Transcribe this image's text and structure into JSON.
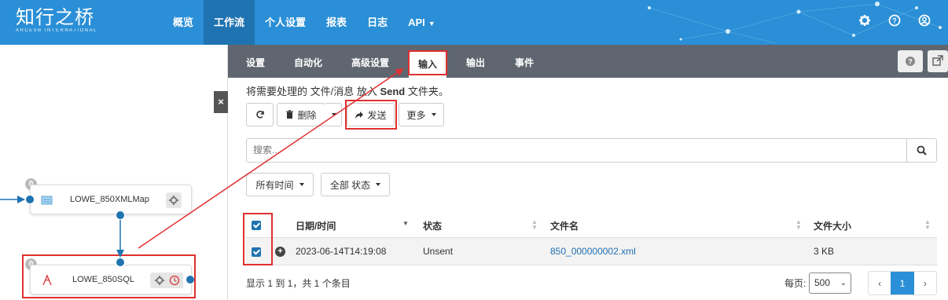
{
  "brand": {
    "name_cn": "知行之桥",
    "name_en": "ARCESB INTERNATIONAL"
  },
  "nav": {
    "items": [
      {
        "label": "概览",
        "active": false
      },
      {
        "label": "工作流",
        "active": true
      },
      {
        "label": "个人设置",
        "active": false
      },
      {
        "label": "报表",
        "active": false
      },
      {
        "label": "日志",
        "active": false
      },
      {
        "label": "API",
        "active": false
      }
    ],
    "icons": [
      "gear-icon",
      "help-icon",
      "user-icon"
    ]
  },
  "canvas": {
    "close_label": "×",
    "nodes": [
      {
        "label": "LOWE_850XMLMap",
        "badge": "0"
      },
      {
        "label": "LOWE_850SQL",
        "badge": "0"
      }
    ]
  },
  "tabs": [
    {
      "label": "设置"
    },
    {
      "label": "自动化"
    },
    {
      "label": "高级设置"
    },
    {
      "label": "输入",
      "active": true
    },
    {
      "label": "输出"
    },
    {
      "label": "事件"
    }
  ],
  "hint": {
    "prefix": "将需要处理的 文件/消息 放入 ",
    "bold": "Send",
    "suffix": " 文件夹。"
  },
  "toolbar": {
    "delete_label": "删除",
    "send_label": "发送",
    "more_label": "更多"
  },
  "search": {
    "placeholder": "搜索..."
  },
  "filters": {
    "time_label": "所有时间",
    "status_label": "全部 状态"
  },
  "table": {
    "headers": [
      "日期/时间",
      "状态",
      "文件名",
      "文件大小"
    ],
    "rows": [
      {
        "datetime": "2023-06-14T14:19:08",
        "status": "Unsent",
        "filename": "850_000000002.xml",
        "size": "3 KB"
      }
    ]
  },
  "footer": {
    "summary": "显示 1 到 1，共 1 个条目",
    "per_page_label": "每页:",
    "per_page_value": "500"
  },
  "pagination": {
    "prev": "‹",
    "current": "1",
    "next": "›"
  },
  "colors": {
    "topbar": "#2a8fd6",
    "tabsbar": "#5f6670",
    "accent": "#1f73b0",
    "highlight": "#e03030"
  }
}
